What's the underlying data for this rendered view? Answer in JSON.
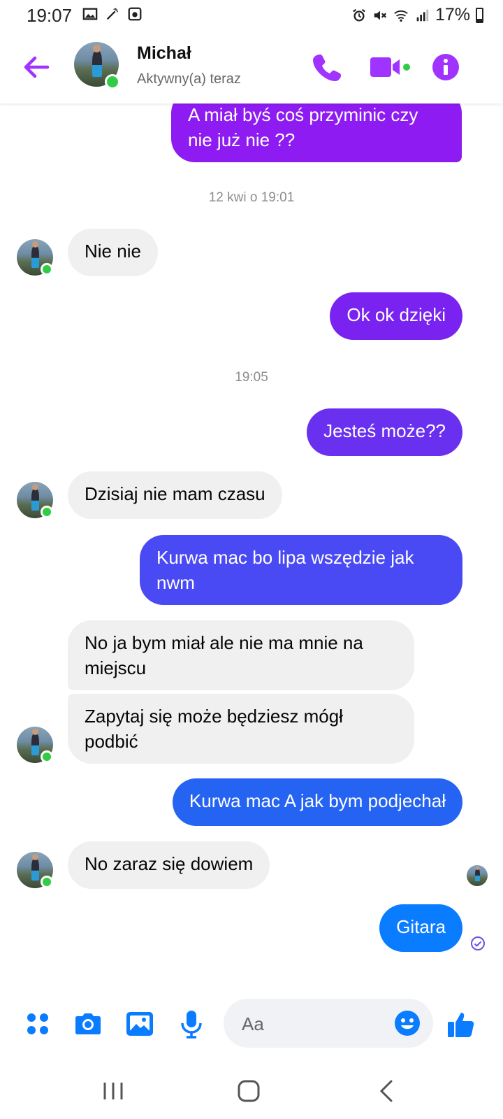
{
  "status_bar": {
    "time": "19:07",
    "battery": "17%",
    "left_icons": [
      "image-icon",
      "wand-icon",
      "recorder-icon"
    ],
    "right_icons": [
      "alarm-icon",
      "mute-icon",
      "wifi-icon",
      "signal-icon",
      "battery-icon"
    ]
  },
  "header": {
    "contact_name": "Michał",
    "presence": "Aktywny(a) teraz",
    "accent_color": "#a033ff"
  },
  "messages": [
    {
      "id": "m1",
      "side": "out",
      "text": "A miał byś coś przyminic czy nie już nie ??",
      "color": "#8e1bf2"
    },
    {
      "id": "t1",
      "type": "timestamp",
      "text": "12 kwi o 19:01"
    },
    {
      "id": "m2",
      "side": "in",
      "text": "Nie nie"
    },
    {
      "id": "m3",
      "side": "out",
      "text": "Ok ok dzięki",
      "color": "#7a23f0"
    },
    {
      "id": "t2",
      "type": "timestamp",
      "text": "19:05"
    },
    {
      "id": "m4",
      "side": "out",
      "text": "Jesteś może??",
      "color": "#6a30f0"
    },
    {
      "id": "m5",
      "side": "in",
      "text": "Dzisiaj nie mam czasu"
    },
    {
      "id": "m6",
      "side": "out",
      "text": "Kurwa mac bo lipa wszędzie jak nwm",
      "color": "#4a4af5"
    },
    {
      "id": "m7",
      "side": "in",
      "text": "No ja bym miał ale nie ma mnie na miejscu"
    },
    {
      "id": "m8",
      "side": "in",
      "text": "Zapytaj się może będziesz mógł podbić"
    },
    {
      "id": "m9",
      "side": "out",
      "text": "Kurwa mac A jak bym podjechał",
      "color": "#2563f2"
    },
    {
      "id": "m10",
      "side": "in",
      "text": "No zaraz się dowiem"
    },
    {
      "id": "m11",
      "side": "out",
      "text": "Gitara",
      "color": "#0a7cff"
    }
  ],
  "composer": {
    "placeholder": "Aa",
    "icon_color": "#0a7cff",
    "icons": [
      "menu-dots-icon",
      "camera-icon",
      "gallery-icon",
      "microphone-icon",
      "emoji-icon",
      "thumbs-up-icon"
    ]
  },
  "nav": {
    "buttons": [
      "recent-apps-icon",
      "home-icon",
      "back-icon"
    ]
  }
}
